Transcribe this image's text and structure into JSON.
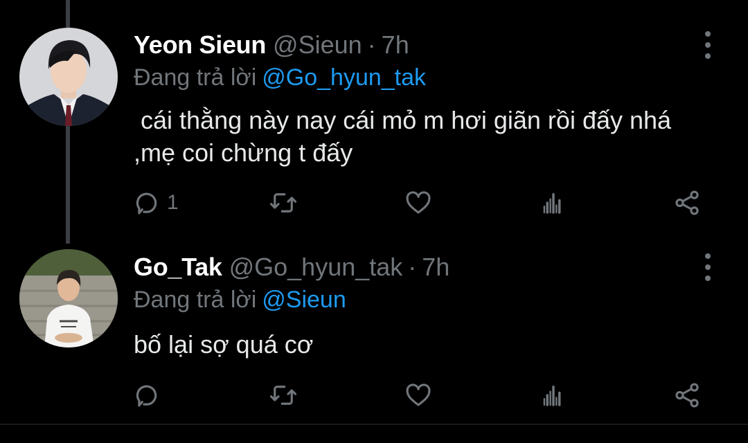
{
  "tweets": [
    {
      "display_name": "Yeon Sieun",
      "handle": "@Sieun",
      "separator": "·",
      "time": "7h",
      "reply_prefix": "Đang trả lời",
      "reply_to": "@Go_hyun_tak",
      "text": " cái thằng này nay cái mỏ m hơi giãn rồi đấy nhá ,mẹ coi chừng t đấy",
      "reply_count": "1",
      "avatar_icon": "profile-photo-man-in-suit"
    },
    {
      "display_name": "Go_Tak",
      "handle": "@Go_hyun_tak",
      "separator": "·",
      "time": "7h",
      "reply_prefix": "Đang trả lời",
      "reply_to": "@Sieun",
      "text": "bố lại sợ quá cơ",
      "reply_count": "",
      "avatar_icon": "profile-photo-man-in-white-sweater"
    }
  ],
  "icons": [
    "reply-icon",
    "retweet-icon",
    "like-icon",
    "analytics-icon",
    "share-icon",
    "more-options-icon"
  ],
  "colors": {
    "background": "#000000",
    "mention": "#1d9bf0",
    "secondary_text": "#71767b",
    "primary_text": "#e7e9ea"
  }
}
